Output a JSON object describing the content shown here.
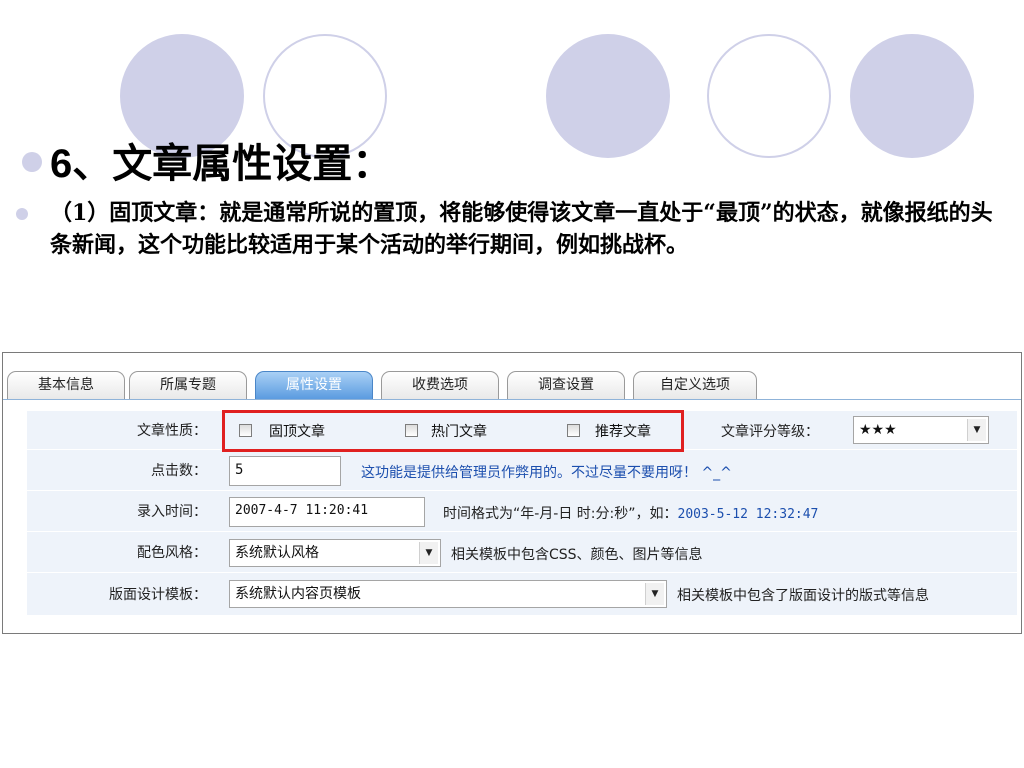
{
  "slide": {
    "heading_number": "6",
    "heading_text": "、文章属性设置：",
    "paragraph": "（1）固顶文章：就是通常所说的置顶，将能够使得该文章一直处于“最顶”的状态，就像报纸的头条新闻，这个功能比较适用于某个活动的举行期间，例如挑战杯。"
  },
  "form": {
    "tabs": [
      {
        "label": "基本信息",
        "active": false
      },
      {
        "label": "所属专题",
        "active": false
      },
      {
        "label": "属性设置",
        "active": true
      },
      {
        "label": "收费选项",
        "active": false
      },
      {
        "label": "调查设置",
        "active": false
      },
      {
        "label": "自定义选项",
        "active": false
      }
    ],
    "article_property": {
      "label": "文章性质：",
      "options": [
        {
          "label": "固顶文章",
          "checked": false
        },
        {
          "label": "热门文章",
          "checked": false
        },
        {
          "label": "推荐文章",
          "checked": false
        }
      ],
      "rating_label": "文章评分等级：",
      "rating_value": "★★★"
    },
    "clicks": {
      "label": "点击数：",
      "value": "5",
      "hint": "这功能是提供给管理员作弊用的。不过尽量不要用呀！ ^_^"
    },
    "entry_time": {
      "label": "录入时间：",
      "value": "2007-4-7 11:20:41",
      "hint_prefix": "时间格式为“年-月-日 时:分:秒”，如：",
      "hint_example": "2003-5-12 12:32:47"
    },
    "color_style": {
      "label": "配色风格：",
      "value": "系统默认风格",
      "hint": "相关模板中包含CSS、颜色、图片等信息"
    },
    "layout_template": {
      "label": "版面设计模板：",
      "value": "系统默认内容页模板",
      "hint": "相关模板中包含了版面设计的版式等信息"
    }
  },
  "colors": {
    "accent_circle": "#cfd0e8",
    "highlight_frame": "#e02020",
    "active_tab": "#5b9be0"
  }
}
